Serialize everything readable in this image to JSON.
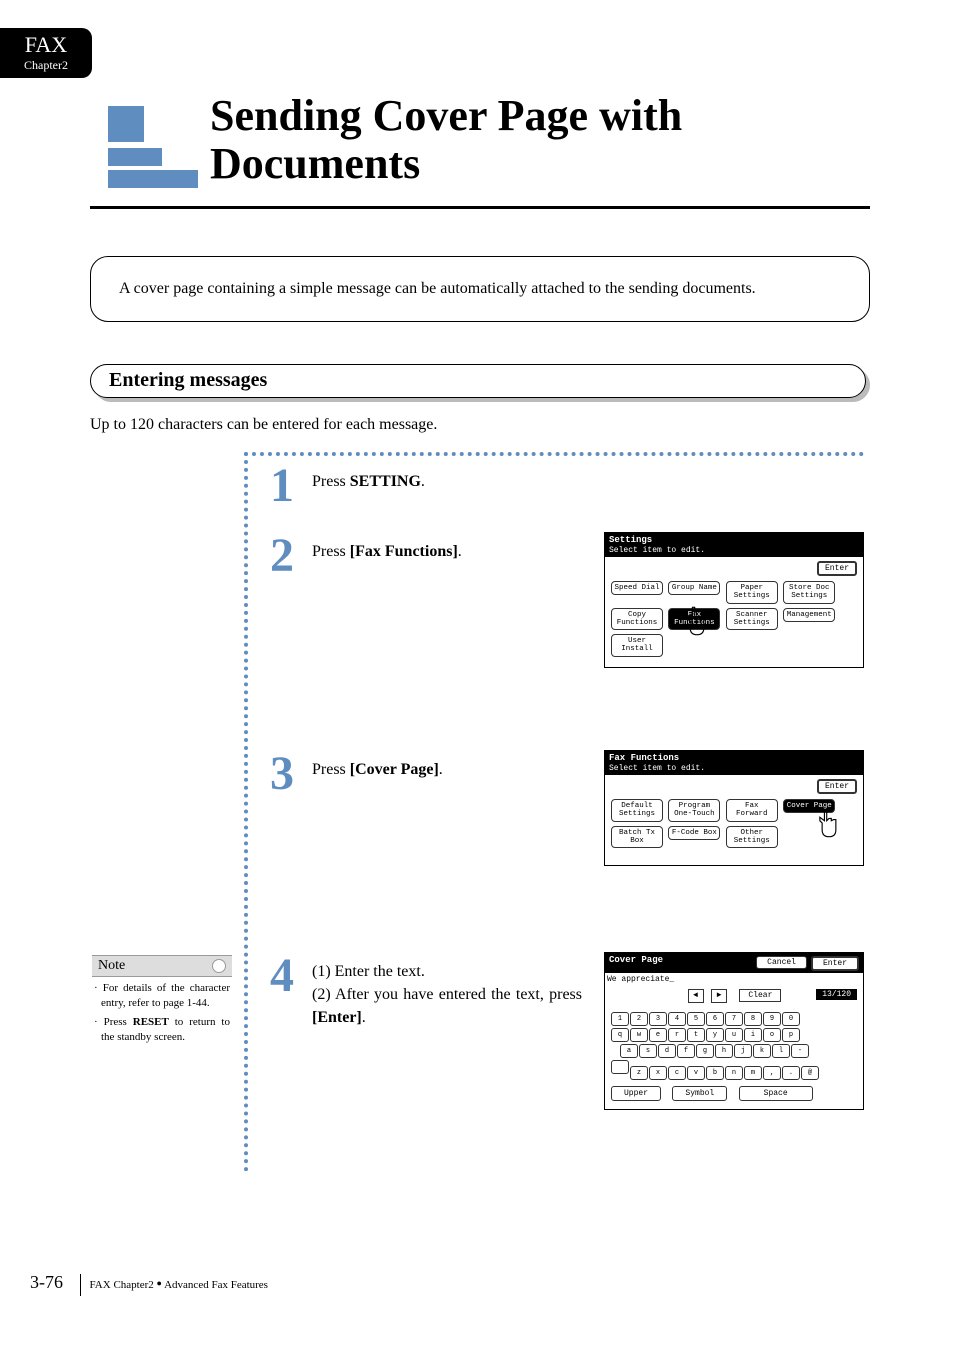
{
  "tab": {
    "title": "FAX",
    "subtitle": "Chapter2"
  },
  "page_title": "Sending Cover Page with Documents",
  "intro": "A cover page containing a simple message can be automatically attached to the sending documents.",
  "subheading": "Entering messages",
  "subnote": "Up to 120 characters can be entered for each message.",
  "steps": {
    "s1": {
      "num": "1",
      "pre": "Press ",
      "bold": "SETTING",
      "post": "."
    },
    "s2": {
      "num": "2",
      "pre": "Press ",
      "bold": "[Fax Functions]",
      "post": "."
    },
    "s3": {
      "num": "3",
      "pre": "Press ",
      "bold": "[Cover Page]",
      "post": "."
    },
    "s4": {
      "num": "4",
      "line1_label": "(1)",
      "line1_text": "Enter the text.",
      "line2_label": "(2)",
      "line2_pre": "After you have entered the text, press ",
      "line2_bold": "[Enter]",
      "line2_post": "."
    }
  },
  "note": {
    "heading": "Note",
    "items": [
      {
        "pre": "· For details of the character entry, refer to page 1-44."
      },
      {
        "pre": "· Press ",
        "bold": "RESET",
        "post": " to return to the standby screen."
      }
    ]
  },
  "lcd_settings": {
    "title": "Settings",
    "subtitle": "Select item to edit.",
    "enter": "Enter",
    "buttons": [
      [
        "Speed Dial",
        "Group Name",
        "Paper Settings",
        "Store Doc Settings"
      ],
      [
        "Copy Functions",
        "Fax Functions",
        "Scanner Settings",
        "Management"
      ],
      [
        "User Install"
      ]
    ],
    "selected": "Fax Functions"
  },
  "lcd_fax": {
    "title": "Fax Functions",
    "subtitle": "Select item to edit.",
    "enter": "Enter",
    "buttons": [
      [
        "Default Settings",
        "Program One-Touch",
        "Fax Forward",
        "Cover Page"
      ],
      [
        "Batch Tx Box",
        "F-Code Box",
        "Other Settings"
      ]
    ],
    "selected": "Cover Page"
  },
  "lcd_cover": {
    "title": "Cover Page",
    "cancel": "Cancel",
    "enter": "Enter",
    "input_text": "We appreciate_",
    "clear": "Clear",
    "counter": "13/120",
    "nav_left": "◄",
    "nav_right": "►",
    "kb": {
      "r1": [
        "1",
        "2",
        "3",
        "4",
        "5",
        "6",
        "7",
        "8",
        "9",
        "0"
      ],
      "r2": [
        "q",
        "w",
        "e",
        "r",
        "t",
        "y",
        "u",
        "i",
        "o",
        "p"
      ],
      "r3": [
        "a",
        "s",
        "d",
        "f",
        "g",
        "h",
        "j",
        "k",
        "l",
        "-"
      ],
      "r4": [
        " ",
        "z",
        "x",
        "c",
        "v",
        "b",
        "n",
        "m",
        ",",
        ".",
        "@"
      ]
    },
    "modes": {
      "upper": "Upper",
      "symbol": "Symbol",
      "space": "Space"
    }
  },
  "footer": {
    "page_num": "3-76",
    "crumb1": "FAX Chapter2",
    "dot": "●",
    "crumb2": "Advanced Fax Features"
  }
}
